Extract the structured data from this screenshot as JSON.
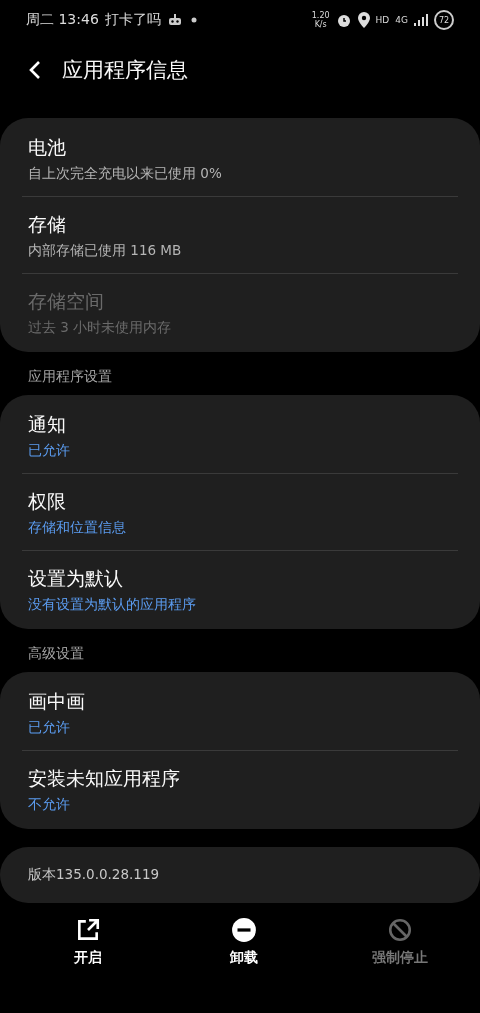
{
  "status_bar": {
    "time": "周二 13:46",
    "notification": "打卡了吗",
    "speed": "1.20",
    "speed_unit": "K/s",
    "hd": "HD",
    "network": "4G",
    "battery": "72"
  },
  "header": {
    "title": "应用程序信息"
  },
  "sections": [
    {
      "items": [
        {
          "kind": "info",
          "title": "电池",
          "subtitle": "自上次完全充电以来已使用 0%",
          "disabled": false
        },
        {
          "kind": "info",
          "title": "存储",
          "subtitle": "内部存储已使用 116 MB",
          "disabled": false
        },
        {
          "kind": "info",
          "title": "存储空间",
          "subtitle": "过去 3 小时未使用内存",
          "disabled": true
        }
      ]
    },
    {
      "label": "应用程序设置",
      "items": [
        {
          "kind": "setting",
          "title": "通知",
          "subtitle": "已允许",
          "disabled": false
        },
        {
          "kind": "setting",
          "title": "权限",
          "subtitle": "存储和位置信息",
          "disabled": false
        },
        {
          "kind": "setting",
          "title": "设置为默认",
          "subtitle": "没有设置为默认的应用程序",
          "disabled": false
        }
      ]
    },
    {
      "label": "高级设置",
      "items": [
        {
          "kind": "setting",
          "title": "画中画",
          "subtitle": "已允许",
          "disabled": false
        },
        {
          "kind": "setting",
          "title": "安装未知应用程序",
          "subtitle": "不允许",
          "disabled": false
        }
      ]
    }
  ],
  "version": "版本135.0.0.28.119",
  "actions": [
    {
      "kind": "open",
      "label": "开启",
      "disabled": false
    },
    {
      "kind": "uninstall",
      "label": "卸载",
      "disabled": false
    },
    {
      "kind": "stop",
      "label": "强制停止",
      "disabled": true
    }
  ]
}
